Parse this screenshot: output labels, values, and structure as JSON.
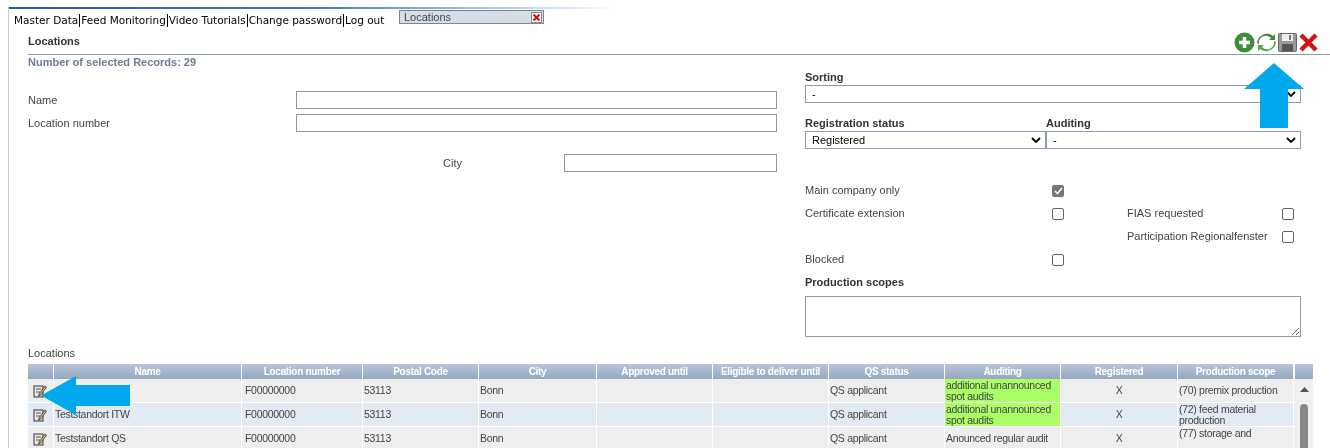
{
  "nav": {
    "links": [
      "Master Data",
      "Feed Monitoring",
      "Video Tutorials",
      "Change password",
      "Log out"
    ]
  },
  "open_tab": {
    "label": "Locations"
  },
  "page": {
    "title": "Locations",
    "record_count": "Number of selected Records: 29"
  },
  "search_fields": [
    {
      "label": "Name",
      "kind": "wide"
    },
    {
      "label": "Location number",
      "kind": "wide"
    },
    {
      "label": "City",
      "kind": "narrow"
    }
  ],
  "sorting": {
    "label": "Sorting",
    "value": "-"
  },
  "registration_status": {
    "label": "Registration status",
    "value": "Registered"
  },
  "auditing": {
    "label": "Auditing",
    "value": "-"
  },
  "option_rows": [
    {
      "left": {
        "label": "Main company only",
        "checked": true
      }
    },
    {
      "left": {
        "label": "Certificate extension",
        "checked": false
      },
      "right": {
        "label": "FIAS requested",
        "checked": false
      }
    },
    {
      "right": {
        "label": "Participation Regionalfenster",
        "checked": false
      }
    },
    {
      "left": {
        "label": "Blocked",
        "checked": false
      }
    }
  ],
  "production_scopes": {
    "label": "Production scopes"
  },
  "table": {
    "title": "Locations",
    "columns": [
      "Name",
      "Location number",
      "Postal Code",
      "City",
      "Approved until",
      "Eligible to deliver until",
      "QS status",
      "Auditing",
      "Registered",
      "Production scope"
    ],
    "rows": [
      {
        "cells": [
          null,
          "F00000000",
          "53113",
          "Bonn",
          null,
          null,
          "QS applicant",
          "additional unannounced spot audits",
          "X",
          "(70) premix production"
        ],
        "auditing_highlighted": true
      },
      {
        "cells": [
          "Teststandort ITW",
          "F00000000",
          "53113",
          "Bonn",
          null,
          null,
          "QS applicant",
          "additional unannounced spot audits",
          "X",
          "(72) feed material production"
        ],
        "auditing_highlighted": true
      },
      {
        "cells": [
          "Teststandort QS",
          "F00000000",
          "53113",
          "Bonn",
          null,
          null,
          "QS applicant",
          "Anounced regular audit",
          "X",
          "(77) storage and"
        ],
        "auditing_highlighted": false
      }
    ]
  }
}
